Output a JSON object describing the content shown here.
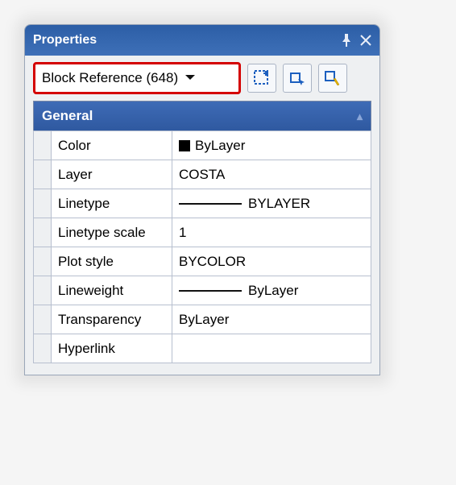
{
  "titlebar": {
    "title": "Properties"
  },
  "toolbar": {
    "selection_label": "Block Reference (648)"
  },
  "section": {
    "header": "General"
  },
  "properties": {
    "color": {
      "label": "Color",
      "value": "ByLayer",
      "swatch": "#000000"
    },
    "layer": {
      "label": "Layer",
      "value": "COSTA"
    },
    "linetype": {
      "label": "Linetype",
      "value": "BYLAYER",
      "line": true
    },
    "linetype_scale": {
      "label": "Linetype scale",
      "value": "1"
    },
    "plot_style": {
      "label": "Plot style",
      "value": "BYCOLOR"
    },
    "lineweight": {
      "label": "Lineweight",
      "value": "ByLayer",
      "line": true
    },
    "transparency": {
      "label": "Transparency",
      "value": "ByLayer"
    },
    "hyperlink": {
      "label": "Hyperlink",
      "value": ""
    }
  }
}
